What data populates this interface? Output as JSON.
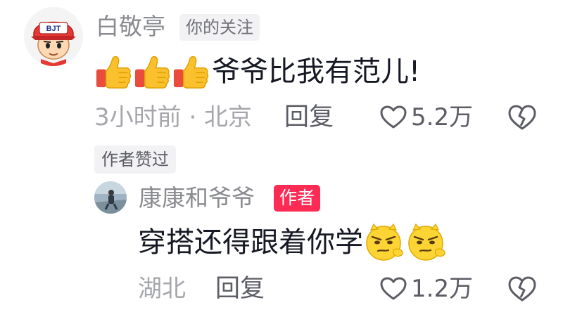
{
  "comment": {
    "avatar_text": "BJT",
    "username": "白敬亭",
    "follow_tag": "你的关注",
    "emojis": [
      "thumbs-up",
      "thumbs-up",
      "thumbs-up"
    ],
    "text": "爷爷比我有范儿!",
    "meta": "3小时前 · 北京",
    "reply_label": "回复",
    "like_count": "5.2万",
    "author_liked_tag": "作者赞过"
  },
  "reply": {
    "username": "康康和爷爷",
    "author_tag": "作者",
    "text": "穿搭还得跟着你学",
    "emojis": [
      "smirk-cat-face",
      "smirk-cat-face"
    ],
    "meta": "湖北",
    "reply_label": "回复",
    "like_count": "1.2万"
  },
  "colors": {
    "primary_text": "#161823",
    "secondary_text": "#8a8b91",
    "muted_text": "#a5a6ab",
    "author_tag_bg": "#fe2c55",
    "tag_bg": "#f2f2f4"
  }
}
